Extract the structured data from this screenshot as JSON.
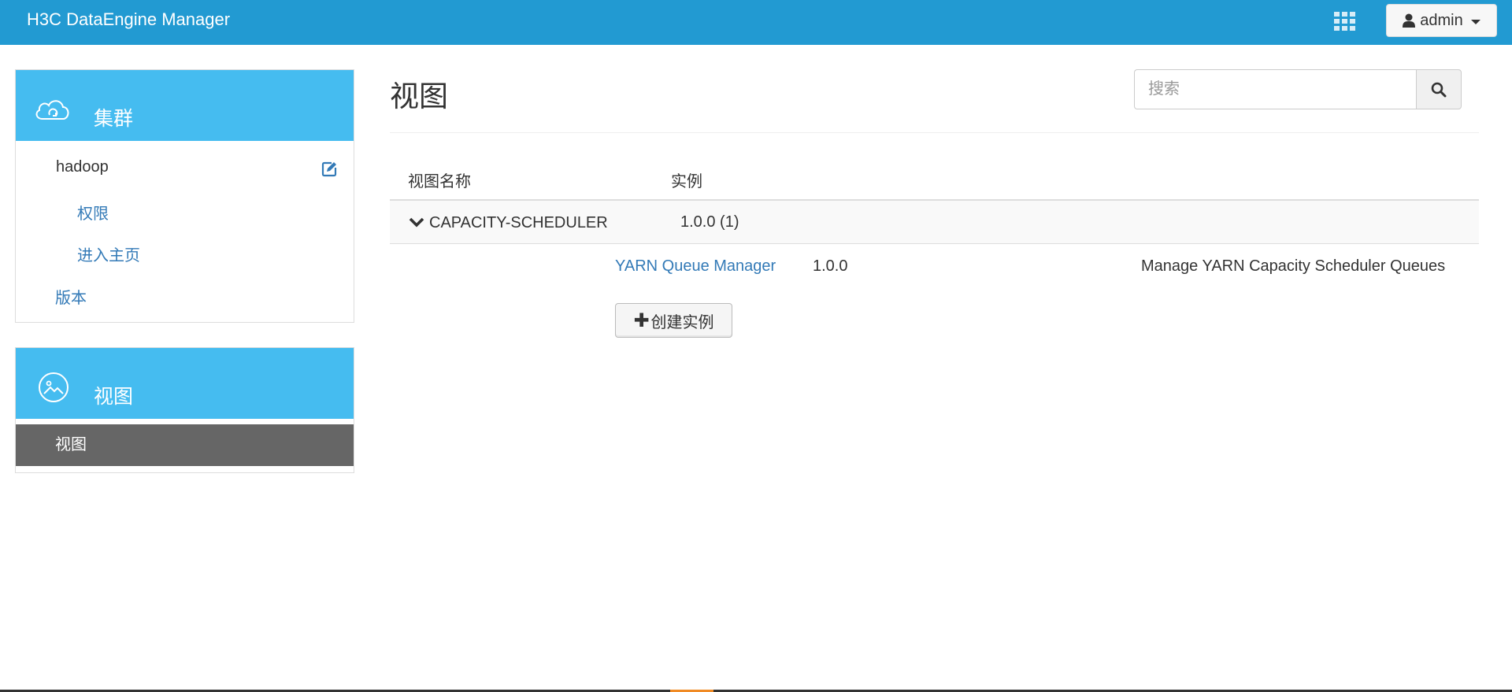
{
  "header": {
    "brand": "H3C DataEngine Manager",
    "apps_icon": "grid-icon",
    "user_label": "admin",
    "user_icon": "user-icon",
    "bg_color": "#229ad2"
  },
  "sidebar": {
    "cluster_panel": {
      "title": "集群",
      "icon": "cloud-icon",
      "cluster_name": "hadoop",
      "edit_icon": "edit-icon",
      "items": [
        {
          "label": "权限"
        },
        {
          "label": "进入主页"
        }
      ],
      "version_label": "版本"
    },
    "views_panel": {
      "title": "视图",
      "icon": "image-icon",
      "active_item": "视图"
    },
    "accent_color": "#45bcf0",
    "active_bg": "#666666"
  },
  "main": {
    "title": "视图",
    "search": {
      "placeholder": "搜索",
      "value": ""
    },
    "table": {
      "columns": [
        "视图名称",
        "实例"
      ],
      "groups": [
        {
          "name": "CAPACITY-SCHEDULER",
          "version": "1.0.0 (1)",
          "expanded": true,
          "instances": [
            {
              "name": "YARN Queue Manager",
              "version": "1.0.0",
              "description": "Manage YARN Capacity Scheduler Queues"
            }
          ]
        }
      ]
    },
    "create_button": "创建实例"
  }
}
